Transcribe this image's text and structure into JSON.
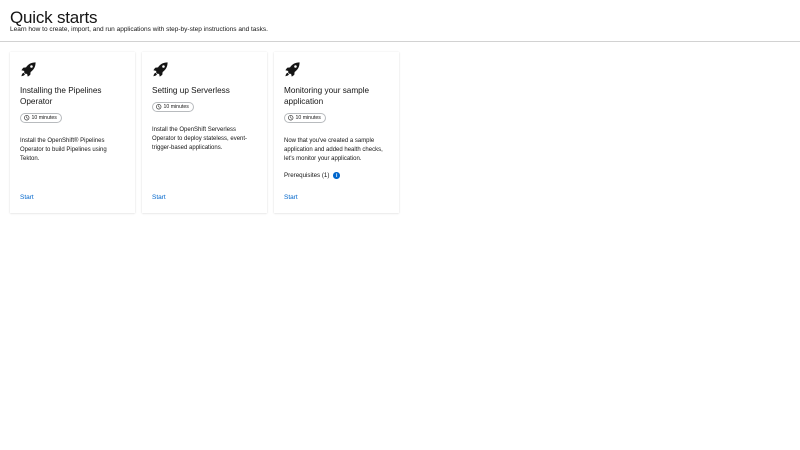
{
  "header": {
    "title": "Quick starts",
    "subtitle": "Learn how to create, import, and run applications with step-by-step instructions and tasks."
  },
  "cards": [
    {
      "icon": "rocket-icon",
      "title": "Installing the Pipelines Operator",
      "duration": "10 minutes",
      "description": "Install the OpenShift® Pipelines Operator to build Pipelines using Tekton.",
      "start_label": "Start"
    },
    {
      "icon": "rocket-icon",
      "title": "Setting up Serverless",
      "duration": "10 minutes",
      "description": "Install the OpenShift Serverless Operator to deploy stateless, event-trigger-based applications.",
      "start_label": "Start"
    },
    {
      "icon": "rocket-icon",
      "title": "Monitoring your sample application",
      "duration": "10 minutes",
      "description": "Now that you've created a sample application and added health checks, let's monitor your application.",
      "prerequisites_label": "Prerequisites (1)",
      "start_label": "Start"
    }
  ],
  "colors": {
    "link": "#0066cc",
    "text": "#151515",
    "border": "#d2d2d2"
  }
}
